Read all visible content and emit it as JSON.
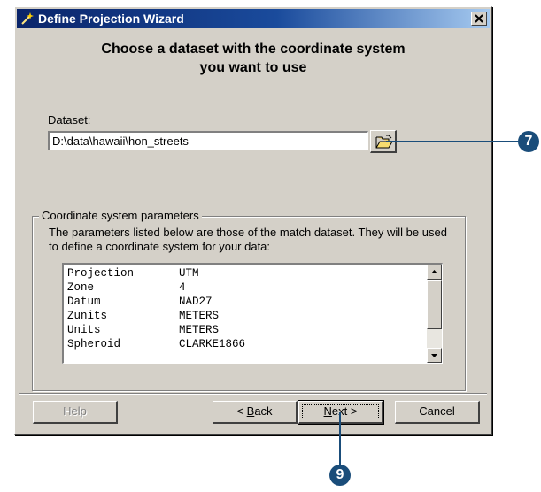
{
  "window": {
    "title": "Define Projection Wizard",
    "heading_line1": "Choose a dataset with the coordinate system",
    "heading_line2": "you want to use"
  },
  "dataset": {
    "label": "Dataset:",
    "value": "D:\\data\\hawaii\\hon_streets",
    "browse_icon": "open-folder-icon"
  },
  "coordinate_group": {
    "legend": "Coordinate system parameters",
    "description": "The parameters listed below are those of the match dataset.  They will be used to define a coordinate system for your data:",
    "parameters": [
      {
        "name": "Projection",
        "value": "UTM"
      },
      {
        "name": "Zone",
        "value": "4"
      },
      {
        "name": "Datum",
        "value": "NAD27"
      },
      {
        "name": "Zunits",
        "value": "METERS"
      },
      {
        "name": "Units",
        "value": "METERS"
      },
      {
        "name": "Spheroid",
        "value": "CLARKE1866"
      }
    ]
  },
  "buttons": {
    "help": "Help",
    "back_prefix": "< ",
    "back_mnemonic": "B",
    "back_rest": "ack",
    "next_mnemonic": "N",
    "next_rest": "ext >",
    "cancel": "Cancel"
  },
  "callouts": [
    {
      "number": "7",
      "target": "browse-button"
    },
    {
      "number": "9",
      "target": "next-button"
    }
  ],
  "colors": {
    "titlebar_start": "#0a246a",
    "titlebar_end": "#a6caf0",
    "dialog_face": "#d4d0c8",
    "callout": "#1a4d7a"
  }
}
